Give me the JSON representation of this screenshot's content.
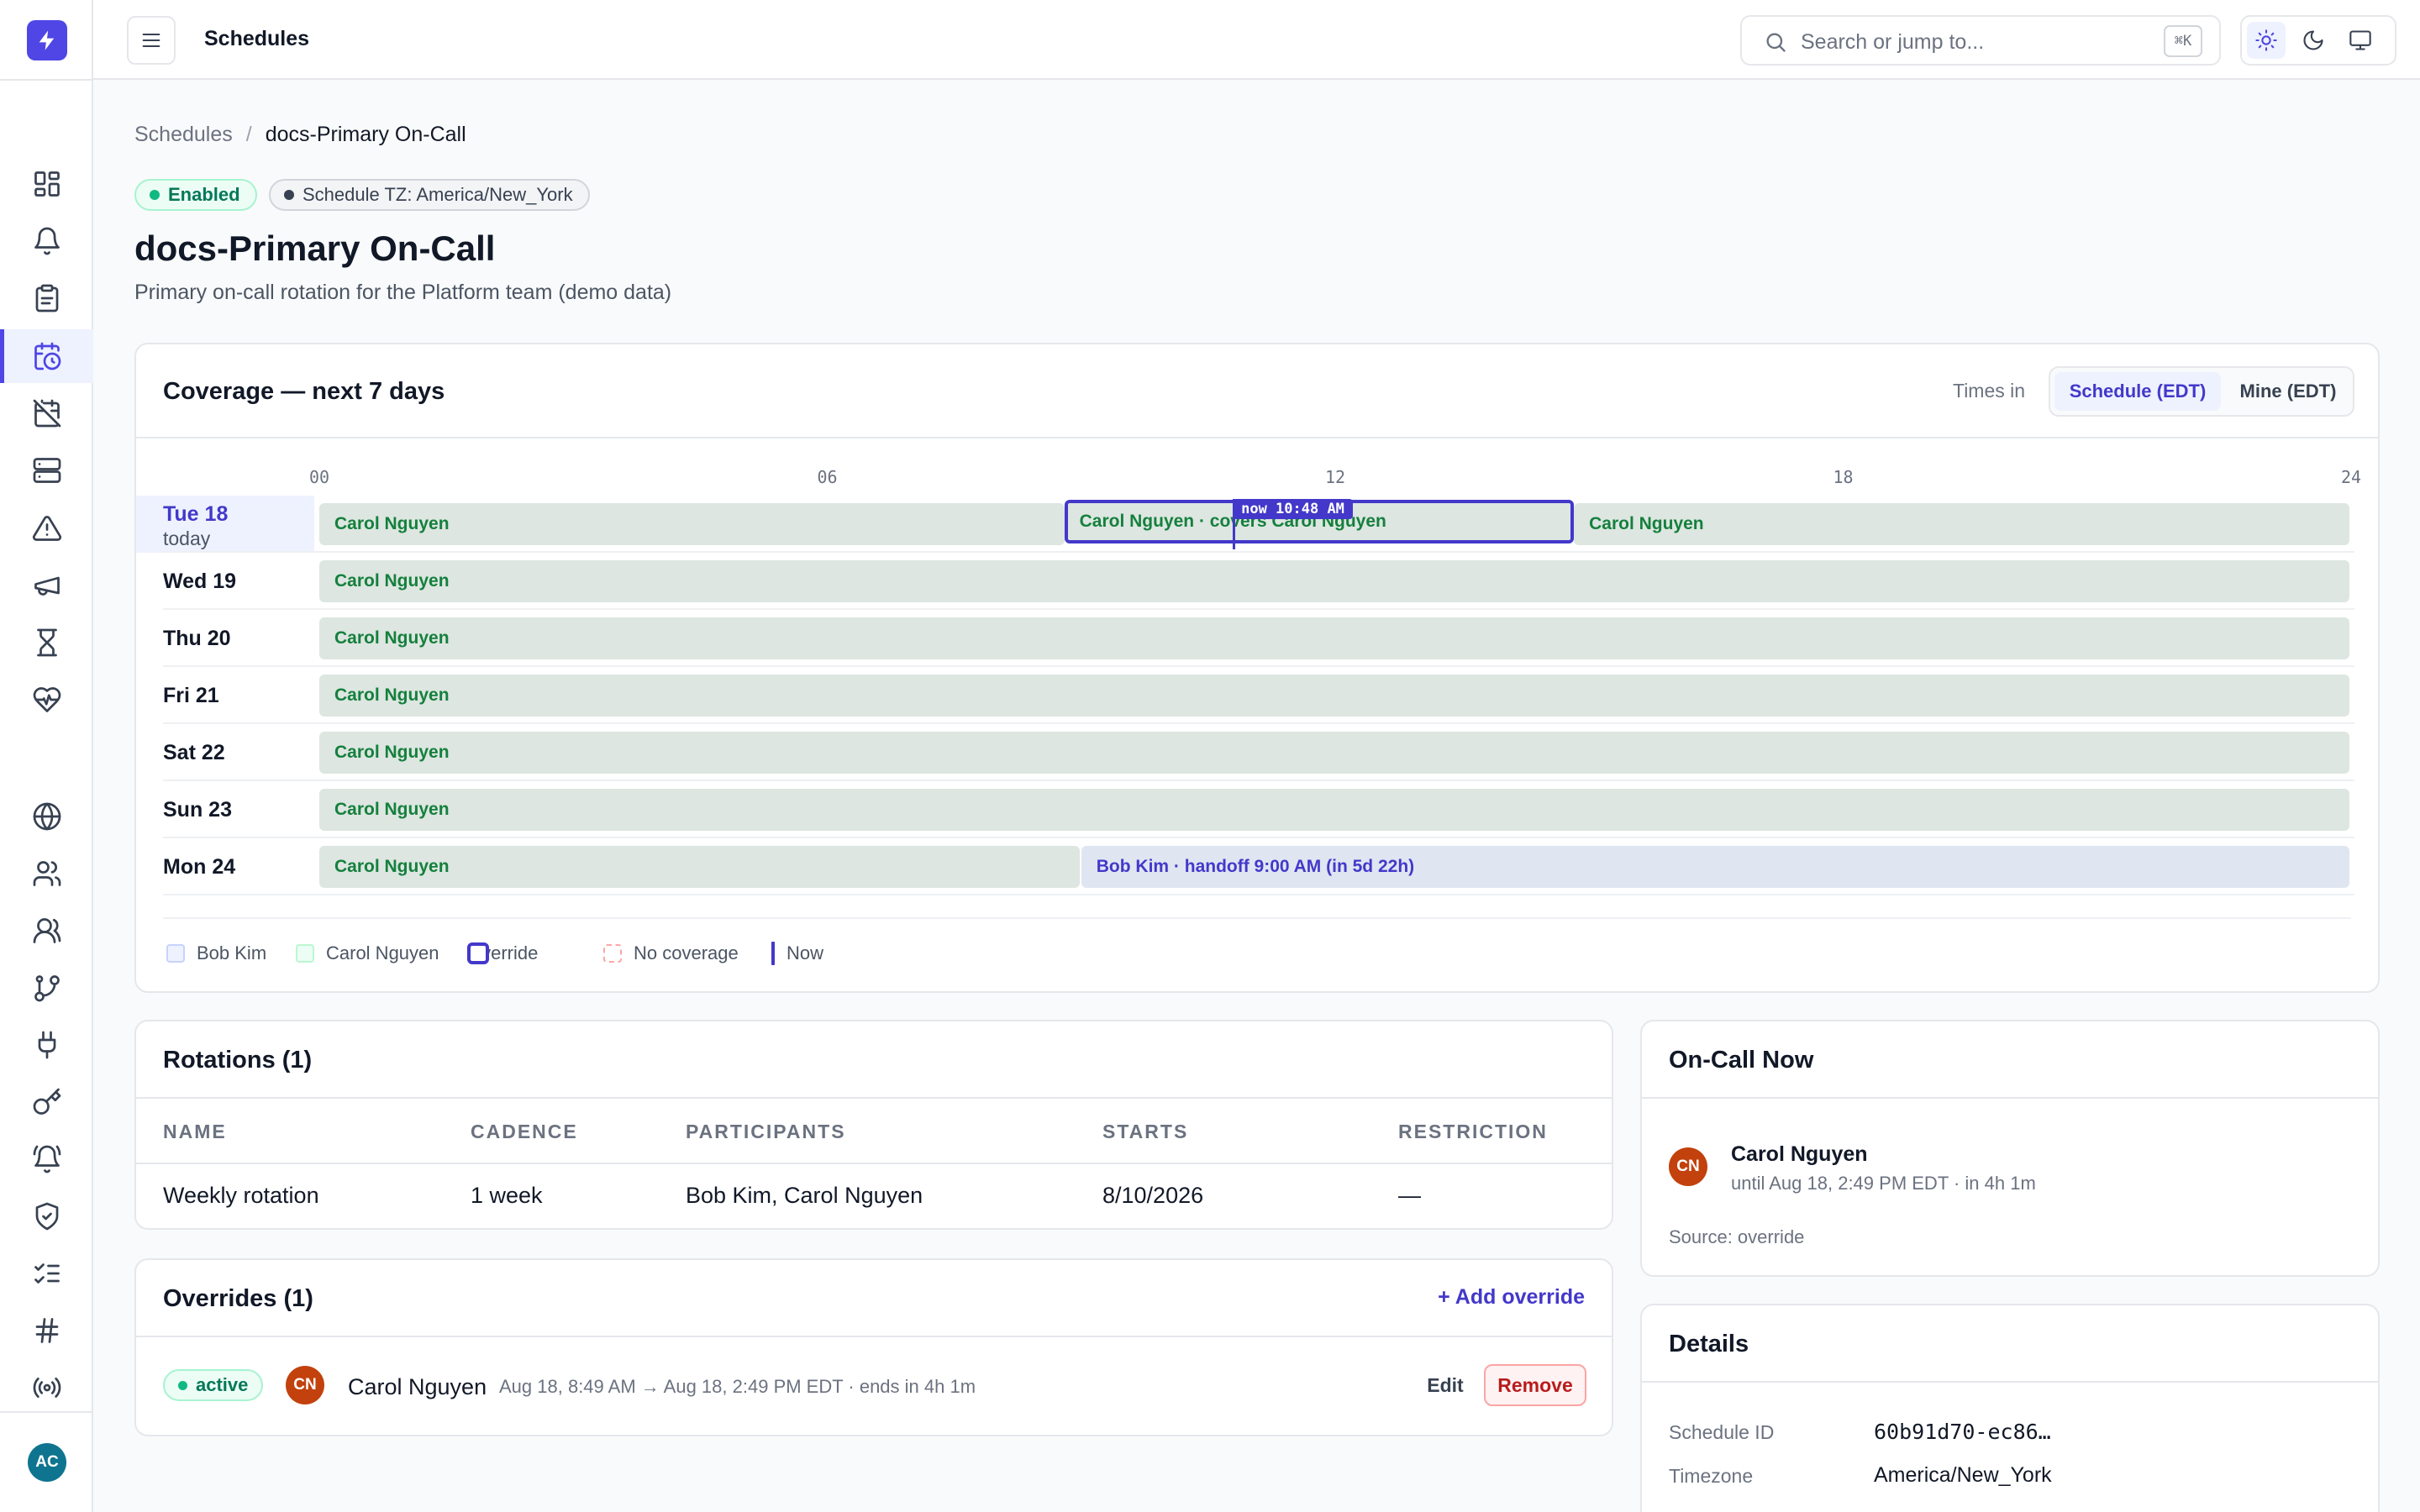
{
  "app": {
    "title": "Schedules"
  },
  "search": {
    "placeholder": "Search or jump to...",
    "shortcut": "⌘K"
  },
  "sidebar": {
    "items": [
      {
        "name": "dashboard",
        "icon": "grid-icon"
      },
      {
        "name": "alerts",
        "icon": "bell-icon"
      },
      {
        "name": "incidents",
        "icon": "clipboard-icon"
      },
      {
        "name": "schedules",
        "icon": "calendar-clock-icon",
        "active": true
      },
      {
        "name": "calendar-off",
        "icon": "calendar-off-icon"
      },
      {
        "name": "services",
        "icon": "server-icon"
      },
      {
        "name": "warnings",
        "icon": "alert-triangle-icon"
      },
      {
        "name": "announcements",
        "icon": "megaphone-icon"
      },
      {
        "name": "timers",
        "icon": "hourglass-icon"
      },
      {
        "name": "health",
        "icon": "heart-pulse-icon"
      },
      {
        "name": "status-pages",
        "icon": "globe-icon"
      },
      {
        "name": "users",
        "icon": "user-icon"
      },
      {
        "name": "teams",
        "icon": "users-icon"
      },
      {
        "name": "workflows",
        "icon": "git-branch-icon"
      },
      {
        "name": "integrations",
        "icon": "plug-icon"
      },
      {
        "name": "api-keys",
        "icon": "key-icon"
      },
      {
        "name": "notification-rules",
        "icon": "bell-ring-icon"
      },
      {
        "name": "security",
        "icon": "shield-icon"
      },
      {
        "name": "tasks",
        "icon": "checklist-icon"
      },
      {
        "name": "channels",
        "icon": "hash-icon"
      },
      {
        "name": "broadcast",
        "icon": "radio-icon"
      }
    ],
    "user_initials": "AC"
  },
  "breadcrumb": {
    "parent": "Schedules",
    "separator": "/",
    "current": "docs-Primary On-Call"
  },
  "badges": {
    "status": "Enabled",
    "tz": "Schedule TZ: America/New_York"
  },
  "page": {
    "title": "docs-Primary On-Call",
    "description": "Primary on-call rotation for the Platform team (demo data)"
  },
  "coverage": {
    "title": "Coverage — next 7 days",
    "times_in_label": "Times in",
    "tz_options": [
      "Schedule (EDT)",
      "Mine (EDT)"
    ],
    "tz_selected": 0,
    "ticks": [
      "00",
      "06",
      "12",
      "18",
      "24"
    ],
    "now": {
      "hour": 10.8,
      "label": "now 10:48 AM"
    },
    "days": [
      {
        "label": "Tue 18",
        "sub": "today",
        "today": true,
        "bars": [
          {
            "start": 0,
            "end": 8.82,
            "who": "carol",
            "text": "Carol Nguyen"
          },
          {
            "start": 14.82,
            "end": 24,
            "who": "carol",
            "text": "Carol Nguyen"
          }
        ],
        "override": {
          "start": 8.82,
          "end": 14.82,
          "text": "Carol Nguyen · covers Carol Nguyen"
        }
      },
      {
        "label": "Wed 19",
        "bars": [
          {
            "start": 0,
            "end": 24,
            "who": "carol",
            "text": "Carol Nguyen"
          }
        ]
      },
      {
        "label": "Thu 20",
        "bars": [
          {
            "start": 0,
            "end": 24,
            "who": "carol",
            "text": "Carol Nguyen"
          }
        ]
      },
      {
        "label": "Fri 21",
        "bars": [
          {
            "start": 0,
            "end": 24,
            "who": "carol",
            "text": "Carol Nguyen"
          }
        ]
      },
      {
        "label": "Sat 22",
        "bars": [
          {
            "start": 0,
            "end": 24,
            "who": "carol",
            "text": "Carol Nguyen"
          }
        ]
      },
      {
        "label": "Sun 23",
        "bars": [
          {
            "start": 0,
            "end": 24,
            "who": "carol",
            "text": "Carol Nguyen"
          }
        ]
      },
      {
        "label": "Mon 24",
        "bars": [
          {
            "start": 0,
            "end": 9,
            "who": "carol",
            "text": "Carol Nguyen"
          },
          {
            "start": 9,
            "end": 24,
            "who": "bob",
            "text": "Bob Kim · handoff 9:00 AM (in 5d 22h)"
          }
        ]
      }
    ],
    "legend": [
      "Bob Kim",
      "Carol Nguyen",
      "Override",
      "No coverage",
      "Now"
    ]
  },
  "rotations": {
    "title": "Rotations (1)",
    "columns": [
      "NAME",
      "CADENCE",
      "PARTICIPANTS",
      "STARTS",
      "RESTRICTION"
    ],
    "rows": [
      [
        "Weekly rotation",
        "1 week",
        "Bob Kim, Carol Nguyen",
        "8/10/2026",
        "—"
      ]
    ]
  },
  "overrides": {
    "title": "Overrides (1)",
    "add_label": "+ Add override",
    "items": [
      {
        "status": "active",
        "initials": "CN",
        "name": "Carol Nguyen",
        "range": "Aug 18, 8:49 AM → Aug 18, 2:49 PM EDT · ends in 4h 1m",
        "edit": "Edit",
        "remove": "Remove"
      }
    ]
  },
  "oncall": {
    "title": "On-Call Now",
    "initials": "CN",
    "name": "Carol Nguyen",
    "until": "until Aug 18, 2:49 PM EDT · in 4h 1m",
    "source": "Source: override"
  },
  "details": {
    "title": "Details",
    "rows": [
      {
        "key": "Schedule ID",
        "value": "60b91d70-ec86…"
      },
      {
        "key": "Timezone",
        "value": "America/New_York"
      }
    ]
  },
  "colors": {
    "accent": "#4f46e5",
    "carol": "#15803d",
    "bob": "#4338ca",
    "danger": "#b91c1c"
  }
}
